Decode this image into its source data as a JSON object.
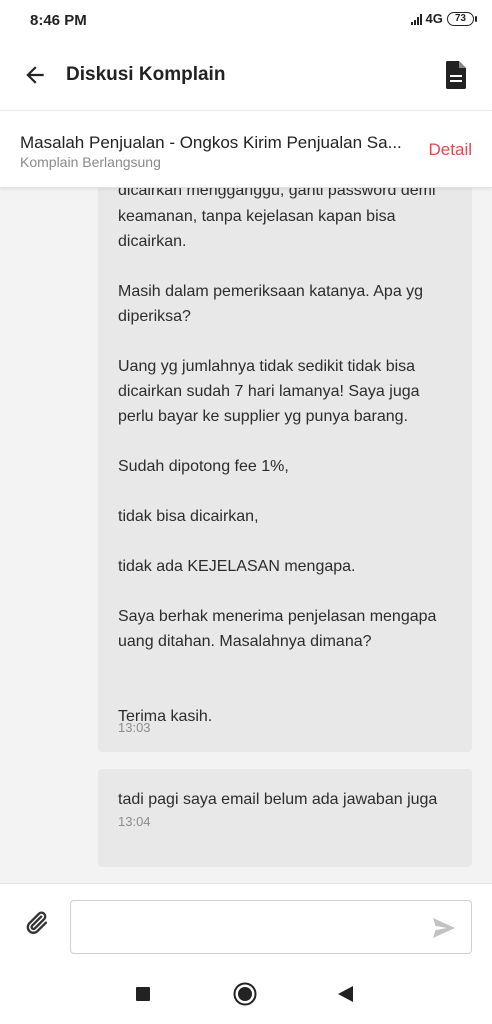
{
  "status_bar": {
    "time": "8:46 PM",
    "network": "4G",
    "battery": "73",
    "icons": [
      "signal-icon",
      "battery-icon"
    ]
  },
  "app_bar": {
    "title": "Diskusi Komplain",
    "icons": [
      "arrow-back-icon",
      "document-icon"
    ]
  },
  "complaint": {
    "title": "Masalah Penjualan - Ongkos Kirim Penjualan Sa...",
    "status": "Komplain Berlangsung",
    "detail_label": "Detail"
  },
  "messages": [
    {
      "partial_top_line": "dicairkan mengganggu, ganti password demi",
      "paragraphs": [
        "keamanan, tanpa kejelasan kapan bisa dicairkan.",
        "Masih dalam pemeriksaan katanya. Apa yg diperiksa?",
        "Uang yg jumlahnya tidak sedikit tidak bisa dicairkan sudah 7 hari lamanya! Saya juga perlu bayar ke supplier yg punya barang.",
        "Sudah dipotong fee 1%,",
        "tidak bisa dicairkan,",
        "tidak ada KEJELASAN mengapa.",
        "Saya berhak menerima penjelasan mengapa uang ditahan. Masalahnya dimana?",
        "Terima kasih."
      ],
      "time": "13:03"
    },
    {
      "paragraphs": [
        "tadi pagi saya email belum ada jawaban juga"
      ],
      "time": "13:04"
    }
  ],
  "composer": {
    "placeholder": "",
    "icons": [
      "paperclip-icon",
      "send-icon"
    ]
  },
  "nav": {
    "icons": [
      "recents-square-icon",
      "home-circle-icon",
      "back-triangle-icon"
    ]
  },
  "colors": {
    "accent": "#e5484d",
    "chat_background": "#f3f3f3",
    "bubble_background": "#e8e8e8"
  }
}
